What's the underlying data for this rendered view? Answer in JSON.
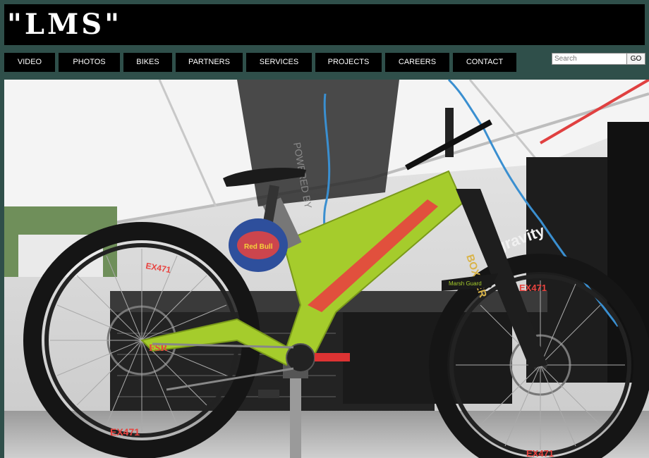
{
  "site": {
    "logo_text": "\"LMS\""
  },
  "nav": {
    "items": [
      {
        "label": "VIDEO"
      },
      {
        "label": "PHOTOS"
      },
      {
        "label": "BIKES"
      },
      {
        "label": "PARTNERS"
      },
      {
        "label": "SERVICES"
      },
      {
        "label": "PROJECTS"
      },
      {
        "label": "CAREERS"
      },
      {
        "label": "CONTACT"
      }
    ]
  },
  "search": {
    "placeholder": "Search",
    "button_label": "GO"
  },
  "hero": {
    "rim_brand": "EX471",
    "fork_brand": "BOXXER",
    "tent_brand": "gravity",
    "tent_text": "POWERED BY",
    "frame_text": "FSR",
    "mudguard_text": "Marsh Guard",
    "helmet_text": "Red Bull"
  },
  "colors": {
    "page_bg": "#2f4f4a",
    "nav_bg": "#000000",
    "frame": "#a5cc2c",
    "accent": "#e8433f"
  }
}
